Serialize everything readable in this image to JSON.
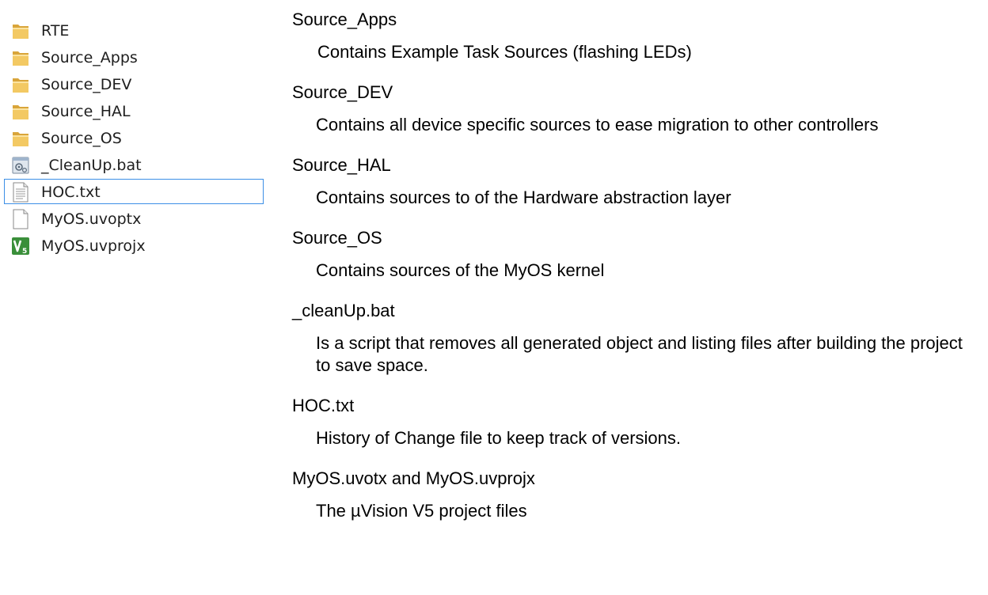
{
  "files": [
    {
      "name": "RTE",
      "icon": "folder-icon",
      "selected": false
    },
    {
      "name": "Source_Apps",
      "icon": "folder-icon",
      "selected": false
    },
    {
      "name": "Source_DEV",
      "icon": "folder-icon",
      "selected": false
    },
    {
      "name": "Source_HAL",
      "icon": "folder-icon",
      "selected": false
    },
    {
      "name": "Source_OS",
      "icon": "folder-icon",
      "selected": false
    },
    {
      "name": "_CleanUp.bat",
      "icon": "batch-file-icon",
      "selected": false
    },
    {
      "name": "HOC.txt",
      "icon": "text-file-icon",
      "selected": true
    },
    {
      "name": "MyOS.uvoptx",
      "icon": "blank-file-icon",
      "selected": false
    },
    {
      "name": "MyOS.uvprojx",
      "icon": "uvision-project-icon",
      "selected": false
    }
  ],
  "entries": [
    {
      "title": "Source_Apps",
      "description": "Contains Example Task Sources (flashing LEDs)"
    },
    {
      "title": "Source_DEV",
      "description": "Contains all device specific sources to ease migration to other controllers"
    },
    {
      "title": "Source_HAL",
      "description": "Contains sources to of the Hardware abstraction layer"
    },
    {
      "title": "Source_OS",
      "description": "Contains sources of the MyOS kernel"
    },
    {
      "title": "_cleanUp.bat",
      "description": "Is a script that removes all generated object and listing files after building the project to save space."
    },
    {
      "title": "HOC.txt",
      "description": "History of Change file to keep track of versions."
    },
    {
      "title": "MyOS.uvotx and MyOS.uvprojx",
      "description": "The µVision V5 project files"
    }
  ],
  "colors": {
    "folder": "#e8b64a",
    "selection_border": "#3c8fe6",
    "uvision_green": "#3a8f3a"
  }
}
